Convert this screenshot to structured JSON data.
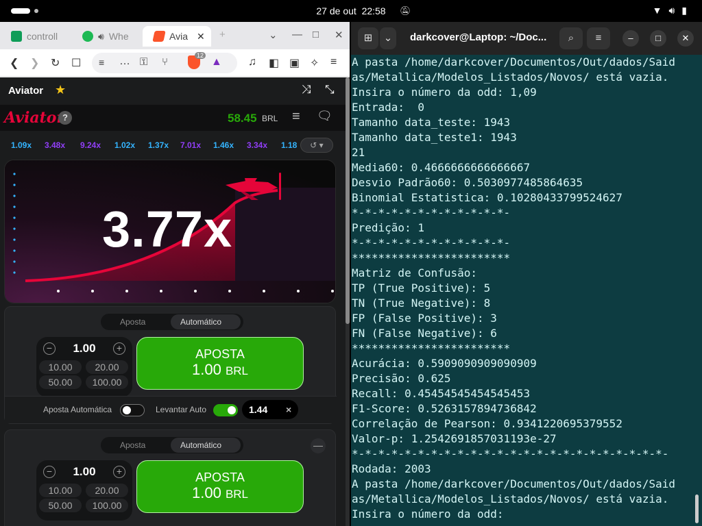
{
  "topbar": {
    "date": "27 de out",
    "time": "22:58"
  },
  "browser": {
    "tabs": [
      {
        "label": "controll",
        "icon": "sheets-icon",
        "color": "#0f9d58"
      },
      {
        "label": "Whe",
        "icon": "spotify-icon",
        "color": "#1db954"
      },
      {
        "label": "Avia",
        "icon": "brave-icon",
        "color": "#fb542b"
      }
    ],
    "brave_badge": "12"
  },
  "game": {
    "title": "Aviator",
    "logo": "Aviator",
    "balance": "58.45",
    "currency": "BRL",
    "multiplier": "3.77x",
    "history": [
      {
        "v": "1.09x",
        "c": "#34b4ff"
      },
      {
        "v": "3.48x",
        "c": "#913ef8"
      },
      {
        "v": "9.24x",
        "c": "#913ef8"
      },
      {
        "v": "1.02x",
        "c": "#34b4ff"
      },
      {
        "v": "1.37x",
        "c": "#34b4ff"
      },
      {
        "v": "7.01x",
        "c": "#913ef8"
      },
      {
        "v": "1.46x",
        "c": "#34b4ff"
      },
      {
        "v": "3.34x",
        "c": "#913ef8"
      },
      {
        "v": "1.18",
        "c": "#34b4ff"
      }
    ],
    "panel1": {
      "tab_bet": "Aposta",
      "tab_auto": "Automático",
      "amount": "1.00",
      "chips": [
        "10.00",
        "20.00",
        "50.00",
        "100.00"
      ],
      "button_line1": "APOSTA",
      "button_amount": "1.00",
      "button_currency": "BRL",
      "auto_bet_label": "Aposta Automática",
      "auto_cashout_label": "Levantar Auto",
      "cashout_value": "1.44",
      "clear": "×"
    },
    "panel2": {
      "tab_bet": "Aposta",
      "tab_auto": "Automático",
      "amount": "1.00",
      "chips": [
        "10.00",
        "20.00",
        "50.00",
        "100.00"
      ],
      "button_line1": "APOSTA",
      "button_amount": "1.00",
      "button_currency": "BRL"
    }
  },
  "terminal": {
    "title": "darkcover@Laptop: ~/Doc...",
    "lines": [
      "A pasta /home/darkcover/Documentos/Out/dados/Said",
      "as/Metallica/Modelos_Listados/Novos/ está vazia.",
      "Insira o número da odd: 1,09",
      "Entrada:  0",
      "Tamanho data_teste: 1943",
      "Tamanho data_teste1: 1943",
      "21",
      "Media60: 0.4666666666666667",
      "Desvio Padrão60: 0.5030977485864635",
      "Binomial Estatistica: 0.10280433799524627",
      "*-*-*-*-*-*-*-*-*-*-*-*-",
      "Predição: 1",
      "*-*-*-*-*-*-*-*-*-*-*-*-",
      "************************",
      "Matriz de Confusão:",
      "TP (True Positive): 5",
      "TN (True Negative): 8",
      "FP (False Positive): 3",
      "FN (False Negative): 6",
      "************************",
      "Acurácia: 0.5909090909090909",
      "Precisão: 0.625",
      "Recall: 0.45454545454545453",
      "F1-Score: 0.5263157894736842",
      "Correlação de Pearson: 0.9341220695379552",
      "Valor-p: 1.2542691857031193e-27",
      "*-*-*-*-*-*-*-*-*-*-*-*-*-*-*-*-*-*-*-*-*-*-*-*-",
      "Rodada: 2003",
      "A pasta /home/darkcover/Documentos/Out/dados/Said",
      "as/Metallica/Modelos_Listados/Novos/ está vazia.",
      "Insira o número da odd: "
    ]
  }
}
